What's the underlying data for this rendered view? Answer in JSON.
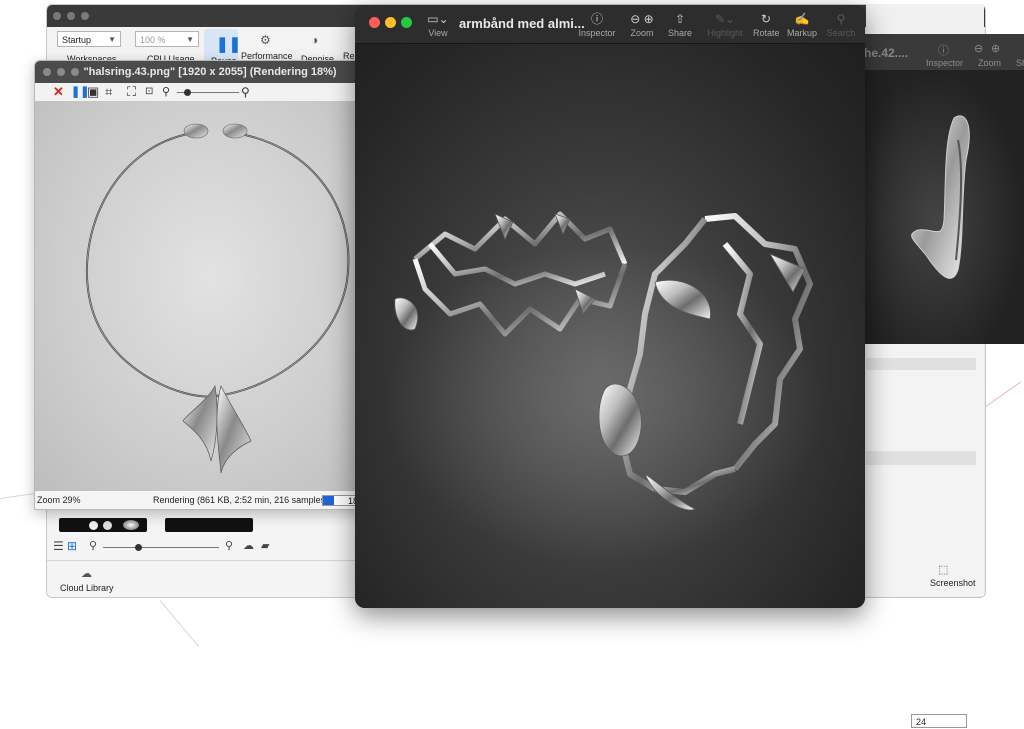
{
  "background_window": {
    "toolbar": {
      "workspace_select": "Startup",
      "workspaces_label": "Workspaces",
      "cpu_select": "100 %",
      "cpu_label": "CPU Usage",
      "pause_label": "Pause",
      "performance_label": "Performance",
      "denoise_label": "Denoise",
      "render_label_partial": "Re"
    },
    "library": {
      "cloud_library_label": "Cloud Library"
    },
    "right_panel": {
      "number_value": "24",
      "screenshot_label": "Screenshot"
    }
  },
  "render_window": {
    "title": "\"halsring.43.png\" [1920 x 2055] (Rendering 18%)",
    "status": {
      "zoom": "Zoom 29%",
      "info": "Rendering (861 KB, 2:52 min, 216 samples)",
      "progress_label": "18",
      "progress": 0.18
    }
  },
  "preview_window": {
    "title": "armbånd med almi...",
    "toolbar": {
      "view": "View",
      "inspector": "Inspector",
      "zoom": "Zoom",
      "share": "Share",
      "highlight": "Highlight",
      "rotate": "Rotate",
      "markup": "Markup",
      "search": "Search"
    }
  },
  "preview_window_2": {
    "title_partial": "he.42....",
    "toolbar": {
      "inspector": "Inspector",
      "zoom": "Zoom",
      "share_partial": "Sh"
    }
  },
  "colors": {
    "accent_blue": "#1e64d6",
    "close_red": "#ff5f57",
    "minimize_yellow": "#febc2e",
    "zoom_green": "#28c840",
    "stop_red": "#e0201b"
  }
}
